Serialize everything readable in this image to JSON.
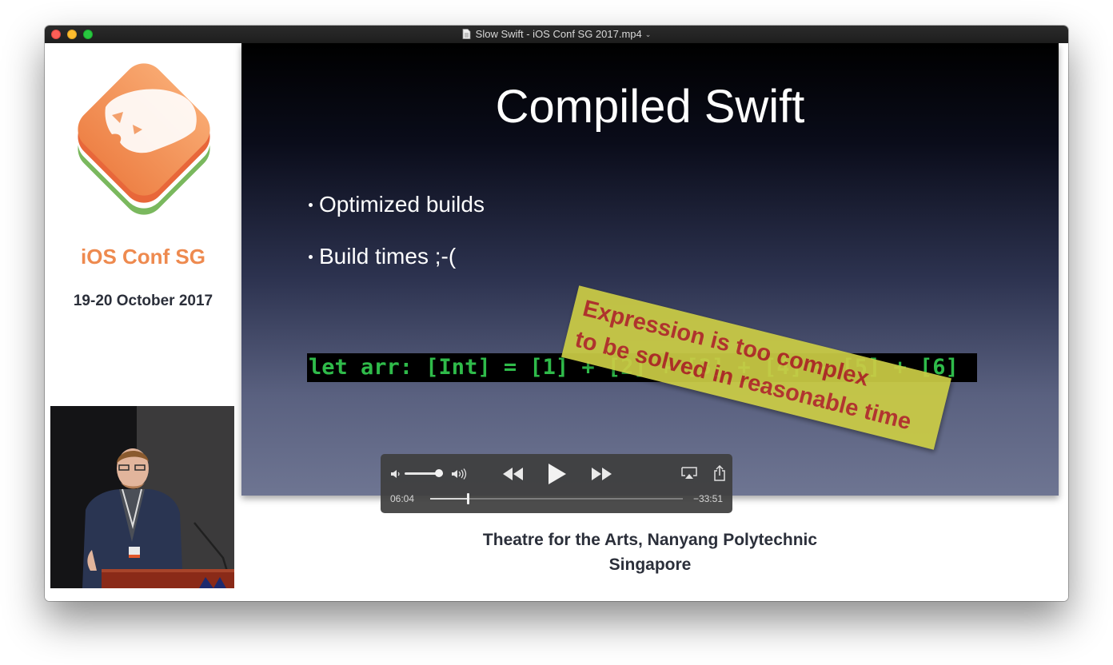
{
  "window": {
    "title": "Slow Swift - iOS Conf SG 2017.mp4"
  },
  "sidebar": {
    "conference_name": "iOS Conf SG",
    "conference_date": "19-20 October 2017"
  },
  "slide": {
    "title": "Compiled Swift",
    "bullets": [
      "Optimized builds",
      "Build times ;-("
    ],
    "code": "let arr: [Int] = [1] + [2] + [3] + [4] + [5] + [6]",
    "sticker_line1": "Expression is too complex",
    "sticker_line2": "to be solved in reasonable time"
  },
  "player": {
    "current_time": "06:04",
    "remaining_time": "−33:51",
    "progress_fraction": 0.15,
    "volume_fraction": 0.9,
    "icons": [
      "volume-low-icon",
      "volume-high-icon",
      "rewind-icon",
      "play-icon",
      "fast-forward-icon",
      "airplay-icon",
      "share-icon"
    ]
  },
  "venue": {
    "line1": "Theatre for the Arts, Nanyang Polytechnic",
    "line2": "Singapore"
  },
  "colors": {
    "brand_orange": "#ee8a4f",
    "code_green": "#2fbb4a",
    "sticker_yellow": "#cbcc45",
    "sticker_red": "#b8322a"
  }
}
